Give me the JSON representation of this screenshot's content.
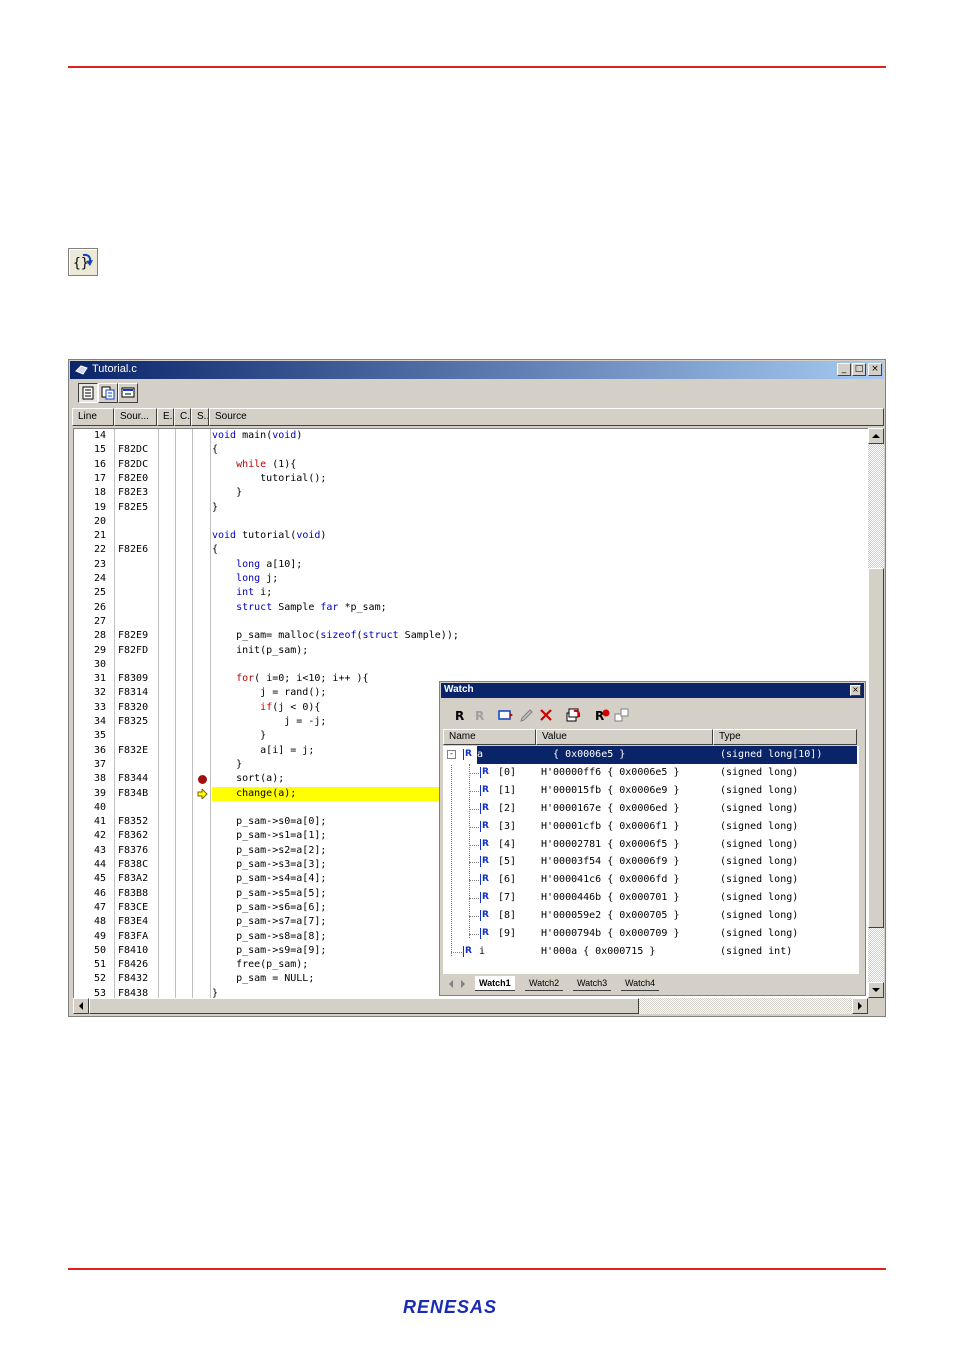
{
  "editor": {
    "title": "Tutorial.c",
    "window_buttons": {
      "minimize": "_",
      "maximize": "□",
      "close": "×"
    },
    "columns": [
      "Line",
      "Sour...",
      "E...",
      "C...",
      "S...",
      "Source"
    ],
    "icons": [
      "source-mode-icon",
      "mixed-mode-icon",
      "disassembly-mode-icon"
    ],
    "rows": [
      {
        "line": "14",
        "addr": "",
        "src": "void main(void)"
      },
      {
        "line": "15",
        "addr": "F82DC",
        "src": "{"
      },
      {
        "line": "16",
        "addr": "F82DC",
        "src": "    while (1){"
      },
      {
        "line": "17",
        "addr": "F82E0",
        "src": "        tutorial();"
      },
      {
        "line": "18",
        "addr": "F82E3",
        "src": "    }"
      },
      {
        "line": "19",
        "addr": "F82E5",
        "src": "}"
      },
      {
        "line": "20",
        "addr": "",
        "src": ""
      },
      {
        "line": "21",
        "addr": "",
        "src": "void tutorial(void)"
      },
      {
        "line": "22",
        "addr": "F82E6",
        "src": "{"
      },
      {
        "line": "23",
        "addr": "",
        "src": "    long a[10];"
      },
      {
        "line": "24",
        "addr": "",
        "src": "    long j;"
      },
      {
        "line": "25",
        "addr": "",
        "src": "    int i;"
      },
      {
        "line": "26",
        "addr": "",
        "src": "    struct Sample far *p_sam;"
      },
      {
        "line": "27",
        "addr": "",
        "src": ""
      },
      {
        "line": "28",
        "addr": "F82E9",
        "src": "    p_sam= malloc(sizeof(struct Sample));"
      },
      {
        "line": "29",
        "addr": "F82FD",
        "src": "    init(p_sam);"
      },
      {
        "line": "30",
        "addr": "",
        "src": ""
      },
      {
        "line": "31",
        "addr": "F8309",
        "src": "    for( i=0; i<10; i++ ){"
      },
      {
        "line": "32",
        "addr": "F8314",
        "src": "        j = rand();"
      },
      {
        "line": "33",
        "addr": "F8320",
        "src": "        if(j < 0){"
      },
      {
        "line": "34",
        "addr": "F8325",
        "src": "            j = -j;"
      },
      {
        "line": "35",
        "addr": "",
        "src": "        }"
      },
      {
        "line": "36",
        "addr": "F832E",
        "src": "        a[i] = j;"
      },
      {
        "line": "37",
        "addr": "",
        "src": "    }"
      },
      {
        "line": "38",
        "addr": "F8344",
        "src": "    sort(a);"
      },
      {
        "line": "39",
        "addr": "F834B",
        "src": "    change(a);"
      },
      {
        "line": "40",
        "addr": "",
        "src": ""
      },
      {
        "line": "41",
        "addr": "F8352",
        "src": "    p_sam->s0=a[0];"
      },
      {
        "line": "42",
        "addr": "F8362",
        "src": "    p_sam->s1=a[1];"
      },
      {
        "line": "43",
        "addr": "F8376",
        "src": "    p_sam->s2=a[2];"
      },
      {
        "line": "44",
        "addr": "F838C",
        "src": "    p_sam->s3=a[3];"
      },
      {
        "line": "45",
        "addr": "F83A2",
        "src": "    p_sam->s4=a[4];"
      },
      {
        "line": "46",
        "addr": "F83B8",
        "src": "    p_sam->s5=a[5];"
      },
      {
        "line": "47",
        "addr": "F83CE",
        "src": "    p_sam->s6=a[6];"
      },
      {
        "line": "48",
        "addr": "F83E4",
        "src": "    p_sam->s7=a[7];"
      },
      {
        "line": "49",
        "addr": "F83FA",
        "src": "    p_sam->s8=a[8];"
      },
      {
        "line": "50",
        "addr": "F8410",
        "src": "    p_sam->s9=a[9];"
      },
      {
        "line": "51",
        "addr": "F8426",
        "src": "    free(p_sam);"
      },
      {
        "line": "52",
        "addr": "F8432",
        "src": "    p_sam = NULL;"
      },
      {
        "line": "53",
        "addr": "F8438",
        "src": "}"
      }
    ],
    "breakpoint_line": "38",
    "current_line": "39"
  },
  "watch": {
    "title": "Watch",
    "close": "×",
    "columns": [
      "Name",
      "Value",
      "Type"
    ],
    "rows": [
      {
        "name": "a",
        "value": "  { 0x0006e5 }",
        "type": "(signed long[10])",
        "expander": "-"
      },
      {
        "name": "[0]",
        "value": "H'00000ff6 { 0x0006e5 }",
        "type": "(signed long)"
      },
      {
        "name": "[1]",
        "value": "H'000015fb { 0x0006e9 }",
        "type": "(signed long)"
      },
      {
        "name": "[2]",
        "value": "H'0000167e { 0x0006ed }",
        "type": "(signed long)"
      },
      {
        "name": "[3]",
        "value": "H'00001cfb { 0x0006f1 }",
        "type": "(signed long)"
      },
      {
        "name": "[4]",
        "value": "H'00002781 { 0x0006f5 }",
        "type": "(signed long)"
      },
      {
        "name": "[5]",
        "value": "H'00003f54 { 0x0006f9 }",
        "type": "(signed long)"
      },
      {
        "name": "[6]",
        "value": "H'000041c6 { 0x0006fd }",
        "type": "(signed long)"
      },
      {
        "name": "[7]",
        "value": "H'0000446b { 0x000701 }",
        "type": "(signed long)"
      },
      {
        "name": "[8]",
        "value": "H'000059e2 { 0x000705 }",
        "type": "(signed long)"
      },
      {
        "name": "[9]",
        "value": "H'0000794b { 0x000709 }",
        "type": "(signed long)"
      },
      {
        "name": "i",
        "value": "H'000a { 0x000715 }",
        "type": "(signed int)"
      }
    ],
    "tabs": [
      "Watch1",
      "Watch2",
      "Watch3",
      "Watch4"
    ],
    "active_tab": "Watch1",
    "row_icon": "R",
    "toolbar_icons": [
      "radix-icon",
      "radix-toggle-icon",
      "add-watch-icon",
      "edit-value-icon",
      "delete-icon",
      "refresh-icon",
      "auto-update-icon",
      "update-mode-icon"
    ]
  },
  "logo": {
    "text": "RENESAS"
  },
  "colors": {
    "accent_red": "#e02020",
    "titlebar": "#0a246a",
    "highlight": "#ffff00",
    "breakpoint": "#a01010"
  }
}
